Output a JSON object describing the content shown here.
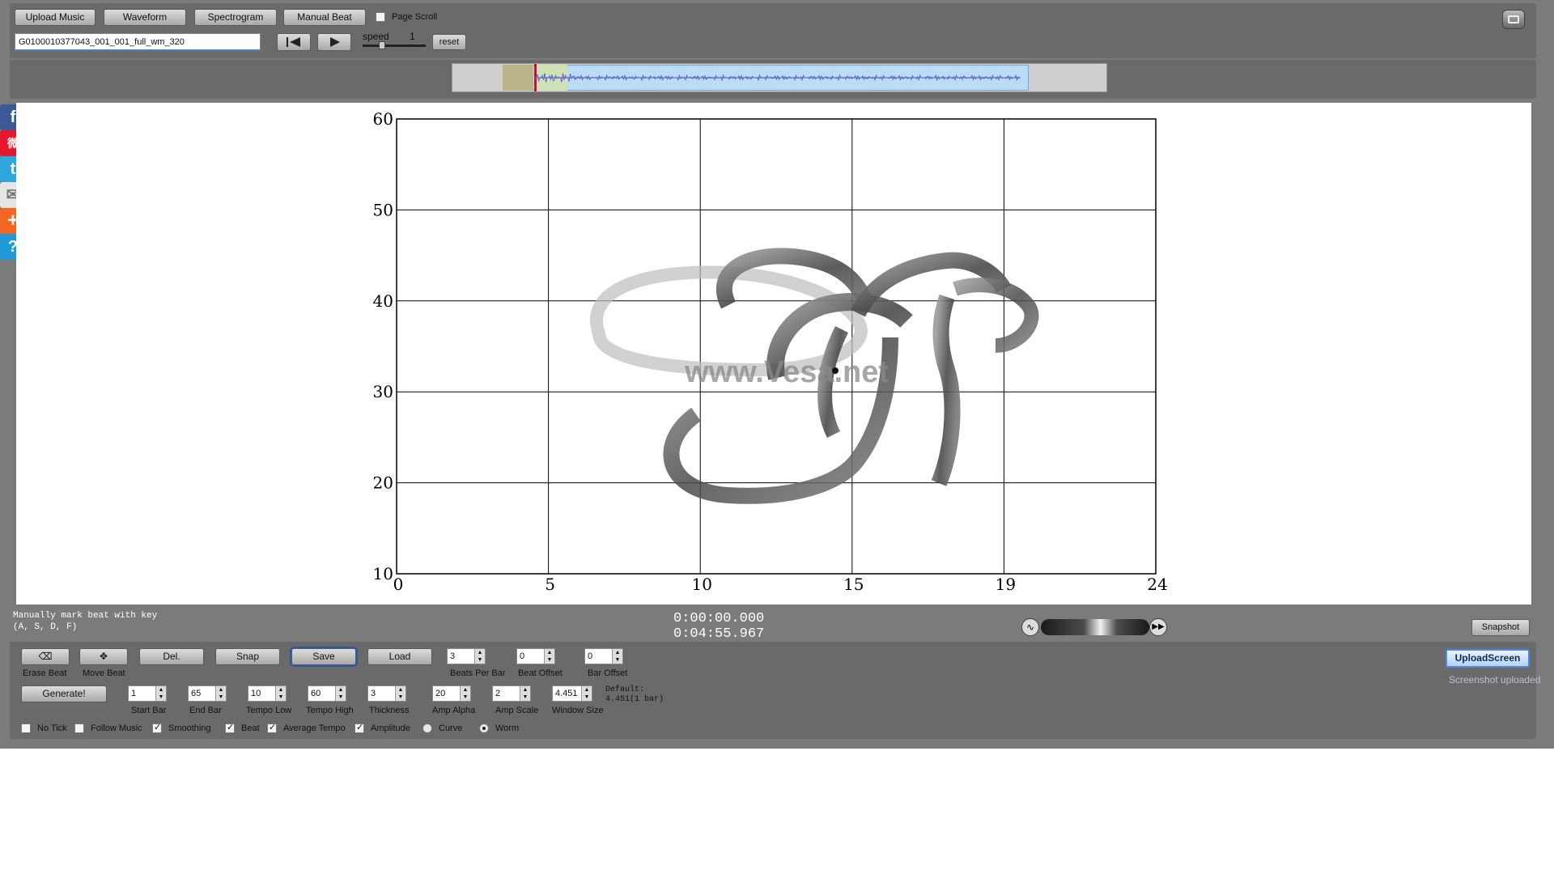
{
  "toolbar": {
    "upload_music": "Upload Music",
    "waveform": "Waveform",
    "spectrogram": "Spectrogram",
    "manual_beat": "Manual Beat",
    "page_scroll": "Page Scroll",
    "filename": "G0100010377043_001_001_full_wm_320",
    "speed_label": "speed",
    "speed_value": "1",
    "reset": "reset"
  },
  "chart_data": {
    "type": "line",
    "title": "",
    "xlabel": "",
    "ylabel": "",
    "xlim": [
      0,
      24
    ],
    "ylim": [
      10,
      60
    ],
    "xticks": [
      "0",
      "5",
      "10",
      "15",
      "19",
      "24"
    ],
    "yticks": [
      "10",
      "20",
      "30",
      "40",
      "50",
      "60"
    ],
    "grid": true,
    "watermark": "www.Vesa.net"
  },
  "status": {
    "hint_line1": "Manually mark beat with key",
    "hint_line2": "(A, S, D, F)",
    "time_current": "0:00:00.000",
    "time_total": "0:04:55.967",
    "snapshot": "Snapshot"
  },
  "controls": {
    "erase_beat": "Erase Beat",
    "move_beat": "Move Beat",
    "del": "Del.",
    "snap": "Snap",
    "save": "Save",
    "load": "Load",
    "beats_per_bar": {
      "label": "Beats Per Bar",
      "value": "3"
    },
    "beat_offset": {
      "label": "Beat Offset",
      "value": "0"
    },
    "bar_offset": {
      "label": "Bar Offset",
      "value": "0"
    },
    "generate": "Generate!",
    "start_bar": {
      "label": "Start Bar",
      "value": "1"
    },
    "end_bar": {
      "label": "End Bar",
      "value": "65"
    },
    "tempo_low": {
      "label": "Tempo Low",
      "value": "10"
    },
    "tempo_high": {
      "label": "Tempo High",
      "value": "60"
    },
    "thickness": {
      "label": "Thickness",
      "value": "3"
    },
    "amp_alpha": {
      "label": "Amp Alpha",
      "value": "20"
    },
    "amp_scale": {
      "label": "Amp Scale",
      "value": "2"
    },
    "window_size": {
      "label": "Window Size",
      "value": "4.451"
    },
    "default_line1": "Default:",
    "default_line2": "4.451(1 bar)",
    "no_tick": "No Tick",
    "follow_music": "Follow Music",
    "smoothing": "Smoothing",
    "beat": "Beat",
    "average_tempo": "Average Tempo",
    "amplitude": "Amplitude",
    "curve": "Curve",
    "worm": "Worm",
    "upload_screen": "UploadScreen",
    "screenshot_uploaded": "Screenshot uploaded"
  },
  "share": {
    "facebook": "f",
    "weibo": "微",
    "twitter": "t",
    "email": "✉",
    "add": "+",
    "help": "?"
  }
}
